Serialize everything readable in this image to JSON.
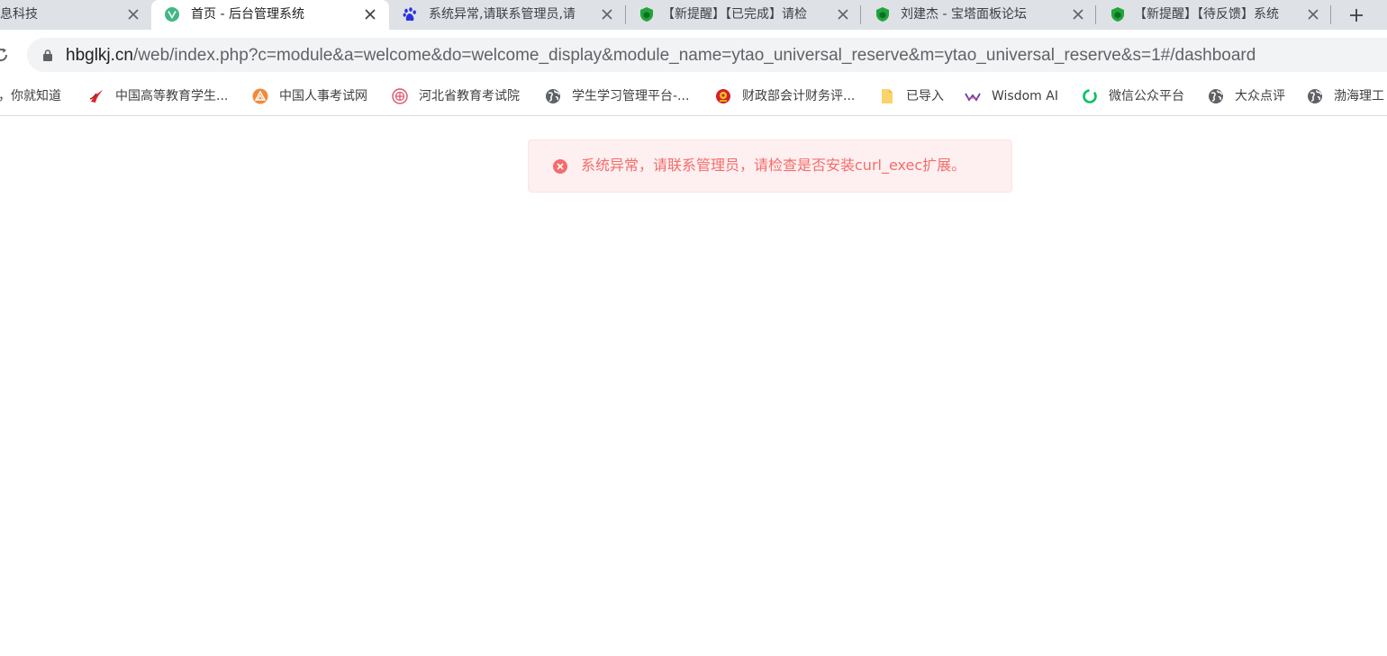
{
  "tabs": [
    {
      "title": "息科技",
      "active": false
    },
    {
      "title": "首页 - 后台管理系统",
      "active": true
    },
    {
      "title": "系统异常,请联系管理员,请",
      "active": false
    },
    {
      "title": "【新提醒】【已完成】请检",
      "active": false
    },
    {
      "title": "刘建杰 - 宝塔面板论坛",
      "active": false
    },
    {
      "title": "【新提醒】【待反馈】系统",
      "active": false
    }
  ],
  "address_bar": {
    "host": "hbglkj.cn",
    "path": "/web/index.php?c=module&a=welcome&do=welcome_display&module_name=ytao_universal_reserve&m=ytao_universal_reserve&s=1#/dashboard"
  },
  "bookmarks": [
    {
      "label": "，你就知道",
      "icon": "none"
    },
    {
      "label": "中国高等教育学生...",
      "icon": "chsi-icon"
    },
    {
      "label": "中国人事考试网",
      "icon": "cpta-icon"
    },
    {
      "label": "河北省教育考试院",
      "icon": "hebeea-icon"
    },
    {
      "label": "学生学习管理平台-...",
      "icon": "globe-icon"
    },
    {
      "label": "财政部会计财务评...",
      "icon": "emblem-icon"
    },
    {
      "label": "已导入",
      "icon": "folder-icon"
    },
    {
      "label": "Wisdom AI",
      "icon": "wisdom-icon"
    },
    {
      "label": "微信公众平台",
      "icon": "wechat-icon"
    },
    {
      "label": "大众点评",
      "icon": "globe-icon"
    },
    {
      "label": "渤海理工",
      "icon": "globe-icon"
    }
  ],
  "message": {
    "type": "error",
    "text": "系统异常，请联系管理员，请检查是否安装curl_exec扩展。",
    "color": "#f56c6c",
    "background": "#fef0f0"
  },
  "colors": {
    "tabstrip": "#dee1e6",
    "omnibox": "#f1f3f4"
  }
}
